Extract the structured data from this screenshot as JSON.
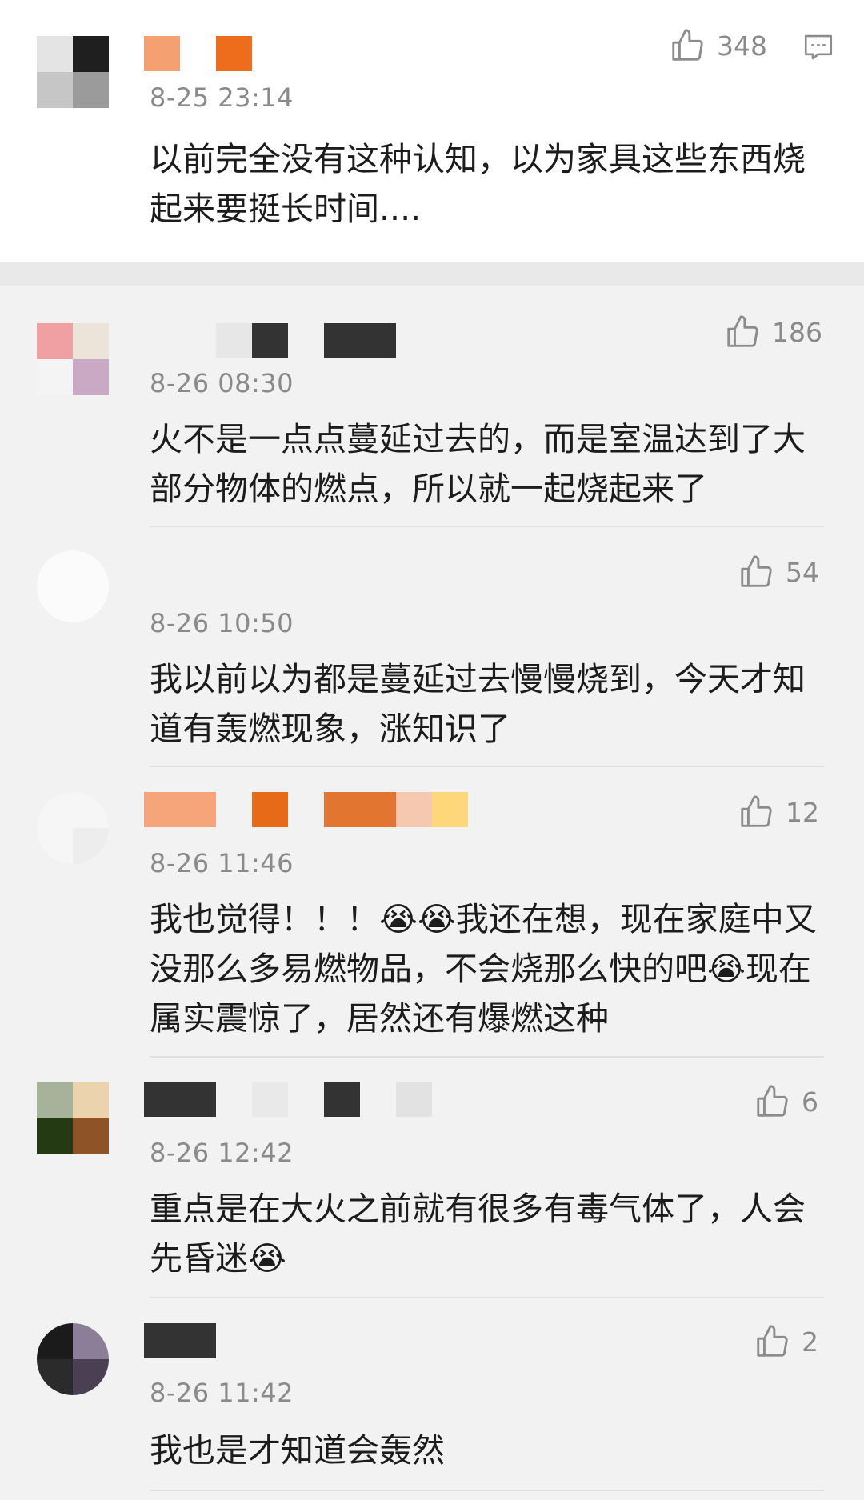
{
  "comments": [
    {
      "time": "8-25 23:14",
      "likes": "348",
      "text": "以前完全没有这种认知，以为家具这些东西烧起来要挺长时间...."
    },
    {
      "time": "8-26 08:30",
      "likes": "186",
      "text": "火不是一点点蔓延过去的，而是室温达到了大部分物体的燃点，所以就一起烧起来了"
    },
    {
      "time": "8-26 10:50",
      "likes": "54",
      "text": "我以前以为都是蔓延过去慢慢烧到，今天才知道有轰燃现象，涨知识了"
    },
    {
      "time": "8-26 11:46",
      "likes": "12",
      "text": "我也觉得！！！😭😭我还在想，现在家庭中又没那么多易燃物品，不会烧那么快的吧😭现在属实震惊了，居然还有爆燃这种"
    },
    {
      "time": "8-26 12:42",
      "likes": "6",
      "text": "重点是在大火之前就有很多有毒气体了，人会先昏迷😭"
    },
    {
      "time": "8-26 11:42",
      "likes": "2",
      "text": "我也是才知道会轰然"
    }
  ],
  "icons": {
    "like": "thumbs-up-icon",
    "reply": "reply-icon"
  },
  "colors": {
    "background": "#f2f2f2",
    "card": "#ffffff",
    "meta_text": "#8a8a8a"
  }
}
